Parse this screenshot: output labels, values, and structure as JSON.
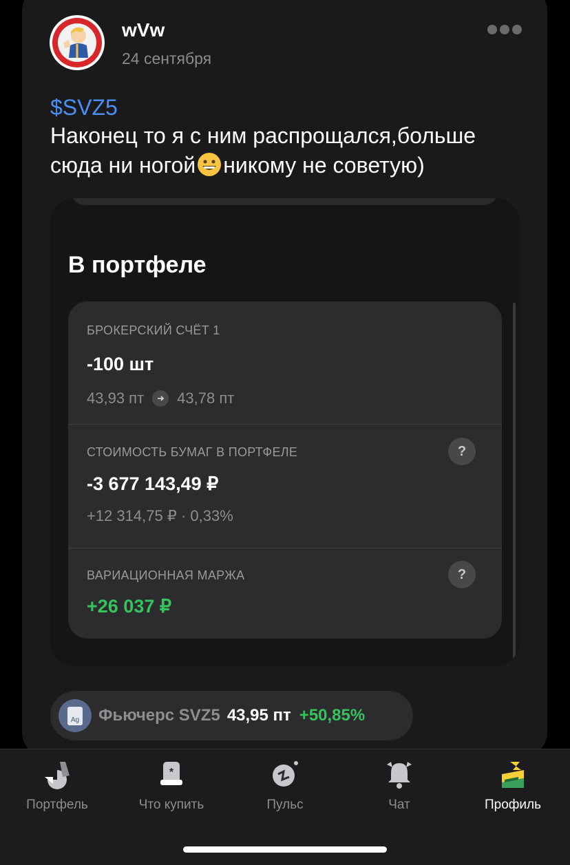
{
  "post": {
    "author": "wVw",
    "date": "24 сентября",
    "ticker": "$SVZ5",
    "text_before_emoji": "Наконец то я с ним распрощался,больше сюда ни ногой",
    "text_after_emoji": "никому не советую)",
    "emoji": "grinning-face-emoji"
  },
  "portfolio": {
    "title": "В портфеле",
    "account_label": "БРОКЕРСКИЙ СЧЁТ 1",
    "quantity": "-100 шт",
    "price_from": "43,93 пт",
    "price_to": "43,78 пт",
    "value_label": "СТОИМОСТЬ БУМАГ В ПОРТФЕЛЕ",
    "value": "-3 677 143,49 ₽",
    "value_change": "+12 314,75 ₽ · 0,33%",
    "margin_label": "ВАРИАЦИОННАЯ МАРЖА",
    "margin_value": "+26 037 ₽",
    "help_glyph": "?"
  },
  "instrument": {
    "name": "Фьючерс SVZ5",
    "price": "43,95 пт",
    "change": "+50,85%",
    "icon_text": "Ag"
  },
  "tabbar": {
    "items": [
      {
        "label": "Портфель",
        "icon": "portfolio-icon"
      },
      {
        "label": "Что купить",
        "icon": "what-to-buy-icon"
      },
      {
        "label": "Пульс",
        "icon": "pulse-icon"
      },
      {
        "label": "Чат",
        "icon": "bell-chat-icon"
      },
      {
        "label": "Профиль",
        "icon": "profile-icon",
        "active": true
      }
    ]
  },
  "colors": {
    "link": "#4a8ff5",
    "positive": "#35c45b",
    "background": "#000000",
    "card": "#1a1a1b"
  }
}
